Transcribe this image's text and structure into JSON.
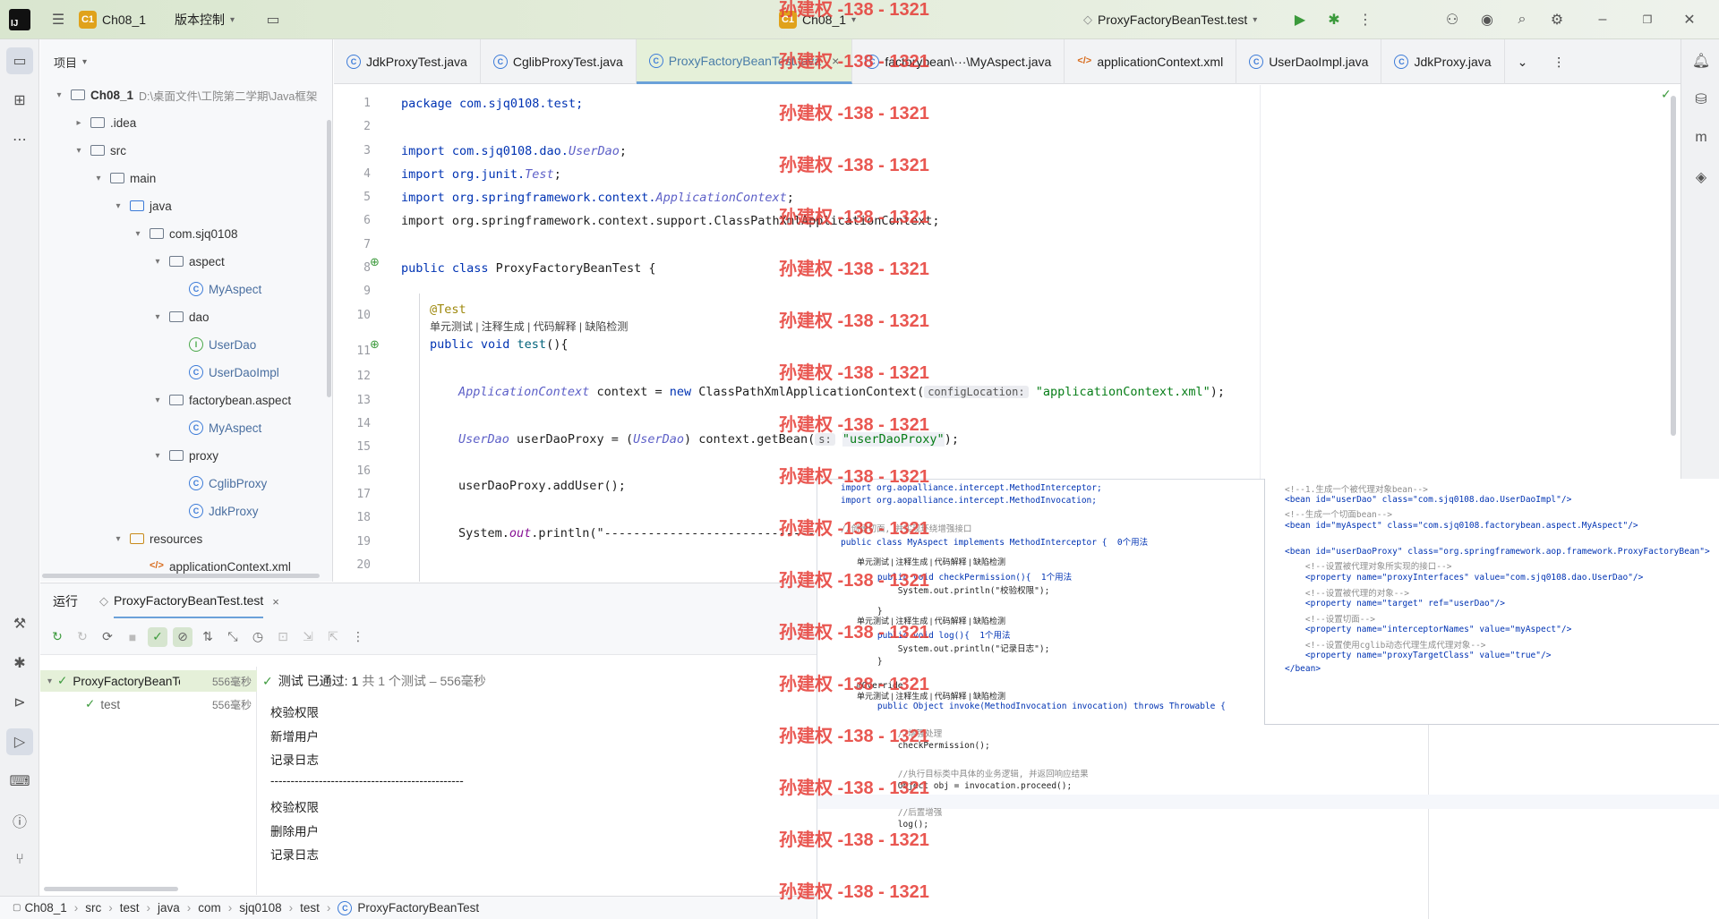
{
  "titlebar": {
    "project_badge": "C1",
    "project_name": "Ch08_1",
    "vcs": "版本控制",
    "center_badge": "C1",
    "center_project": "Ch08_1",
    "run_config": "ProxyFactoryBeanTest.test"
  },
  "project_panel": {
    "title": "项目",
    "tree": [
      {
        "label": "Ch08_1",
        "path": "D:\\桌面文件\\工院第二学期\\Java框架",
        "type": "module",
        "depth": 0,
        "open": true
      },
      {
        "label": ".idea",
        "type": "folder",
        "depth": 1,
        "open": false
      },
      {
        "label": "src",
        "type": "folder",
        "depth": 1,
        "open": true
      },
      {
        "label": "main",
        "type": "folder",
        "depth": 2,
        "open": true
      },
      {
        "label": "java",
        "type": "folder",
        "depth": 3,
        "open": true
      },
      {
        "label": "com.sjq0108",
        "type": "package",
        "depth": 4,
        "open": true
      },
      {
        "label": "aspect",
        "type": "package",
        "depth": 5,
        "open": true
      },
      {
        "label": "MyAspect",
        "type": "class",
        "depth": 6
      },
      {
        "label": "dao",
        "type": "package",
        "depth": 5,
        "open": true
      },
      {
        "label": "UserDao",
        "type": "interface",
        "depth": 6
      },
      {
        "label": "UserDaoImpl",
        "type": "class",
        "depth": 6
      },
      {
        "label": "factorybean.aspect",
        "type": "package",
        "depth": 5,
        "open": true
      },
      {
        "label": "MyAspect",
        "type": "class",
        "depth": 6
      },
      {
        "label": "proxy",
        "type": "package",
        "depth": 5,
        "open": true
      },
      {
        "label": "CglibProxy",
        "type": "class",
        "depth": 6
      },
      {
        "label": "JdkProxy",
        "type": "class",
        "depth": 6
      },
      {
        "label": "resources",
        "type": "folder",
        "depth": 3,
        "open": true
      },
      {
        "label": "applicationContext.xml",
        "type": "xml",
        "depth": 4
      }
    ]
  },
  "tabs": [
    {
      "label": "JdkProxyTest.java"
    },
    {
      "label": "CglibProxyTest.java"
    },
    {
      "label": "ProxyFactoryBeanTest.java",
      "active": true,
      "close": "×"
    },
    {
      "label": "factorybean\\···\\MyAspect.java"
    },
    {
      "label": "applicationContext.xml"
    },
    {
      "label": "UserDaoImpl.java"
    },
    {
      "label": "JdkProxy.java"
    }
  ],
  "editor": {
    "line_numbers": [
      "1",
      "2",
      "3",
      "4",
      "5",
      "6",
      "7",
      "8",
      "9",
      "10",
      "11",
      "12",
      "13",
      "14",
      "15",
      "16",
      "17",
      "18",
      "19",
      "20"
    ],
    "lines": {
      "l1": "package com.sjq0108.test;",
      "l3a": "import com.sjq0108.dao.",
      "l3b": "UserDao",
      "l3c": ";",
      "l4a": "import org.junit.",
      "l4b": "Test",
      "l4c": ";",
      "l5a": "import org.springframework.context.",
      "l5b": "ApplicationContext",
      "l5c": ";",
      "l6": "import org.springframework.context.support.ClassPathXmlApplicationContext;",
      "l8a": "public class ",
      "l8b": "ProxyFactoryBeanTest {",
      "l10": "@Test",
      "l10hint": "单元测试 | 注释生成 | 代码解释 | 缺陷检测",
      "l11a": "public void ",
      "l11b": "test",
      "l11c": "(){",
      "l13a": "ApplicationContext",
      "l13b": " context = ",
      "l13c": "new ",
      "l13d": "ClassPathXmlApplicationContext(",
      "l13hint": "configLocation:",
      "l13e": "\"applicationContext.xml\"",
      "l13f": ");",
      "l15a": "UserDao",
      "l15b": " userDaoProxy = (",
      "l15c": "UserDao",
      "l15d": ") context.getBean(",
      "l15hint": "s:",
      "l15e": "\"userDaoProxy\"",
      "l15f": ");",
      "l17": "userDaoProxy.addUser();",
      "l19a": "System.",
      "l19b": "out",
      "l19c": ".println(\"-------------------------------"
    }
  },
  "run_panel": {
    "tab_run": "运行",
    "tab_test": "ProxyFactoryBeanTest.test",
    "tab_close": "×",
    "tree_root": "ProxyFactoryBeanTes",
    "tree_root_time": "556毫秒",
    "tree_child": "test",
    "tree_child_time": "556毫秒",
    "status_prefix": "测试 已通过:",
    "status_count": "1",
    "status_rest": "共 1 个测试 – 556毫秒",
    "output": [
      "校验权限",
      "新增用户",
      "记录日志",
      "------------------------------------------------",
      "校验权限",
      "删除用户",
      "记录日志"
    ]
  },
  "breadcrumb": [
    "Ch08_1",
    "src",
    "test",
    "java",
    "com",
    "sjq0108",
    "test",
    "ProxyFactoryBeanTest"
  ],
  "overlay_java": [
    "import org.aopalliance.intercept.MethodInterceptor;",
    "import org.aopalliance.intercept.MethodInvocation;",
    "//创建切面, 并实现环绕增强接口",
    "public class MyAspect implements MethodInterceptor {  0个用法",
    "单元测试 | 注释生成 | 代码解释 | 缺陷检测",
    "    public void checkPermission(){  1个用法",
    "        System.out.println(\"校验权限\");",
    "    }",
    "单元测试 | 注释生成 | 代码解释 | 缺陷检测",
    "    public void log(){  1个用法",
    "        System.out.println(\"记录日志\");",
    "    }",
    "@Override",
    "单元测试 | 注释生成 | 代码解释 | 缺陷检测",
    "    public Object invoke(MethodInvocation invocation) throws Throwable {",
    "        //增强处理",
    "        checkPermission();",
    "        //执行目标类中具体的业务逻辑, 并返回响应结果",
    "        Object obj = invocation.proceed();",
    "        //后置增强",
    "        log();"
  ],
  "overlay_xml": [
    "<!--1.生成一个被代理对象bean-->",
    "<bean id=\"userDao\" class=\"com.sjq0108.dao.UserDaoImpl\"/>",
    "<!--生成一个切面bean-->",
    "<bean id=\"myAspect\" class=\"com.sjq0108.factorybean.aspect.MyAspect\"/>",
    "<bean id=\"userDaoProxy\" class=\"org.springframework.aop.framework.ProxyFactoryBean\">",
    "    <!--设置被代理对象所实现的接口-->",
    "    <property name=\"proxyInterfaces\" value=\"com.sjq0108.dao.UserDao\"/>",
    "    <!--设置被代理的对象-->",
    "    <property name=\"target\" ref=\"userDao\"/>",
    "    <!--设置切面-->",
    "    <property name=\"interceptorNames\" value=\"myAspect\"/>",
    "    <!--设置使用cglib动态代理生成代理对象-->",
    "    <property name=\"proxyTargetClass\" value=\"true\"/>",
    "</bean>"
  ],
  "watermark": "孙建权 -138 - 1321",
  "colors": {
    "accent": "#6ba1d9",
    "pass": "#3c9a3c",
    "watermark": "#e6403a"
  }
}
